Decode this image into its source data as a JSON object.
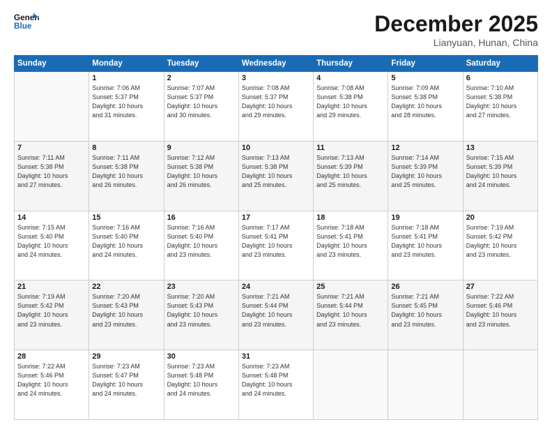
{
  "header": {
    "logo_general": "General",
    "logo_blue": "Blue",
    "month": "December 2025",
    "location": "Lianyuan, Hunan, China"
  },
  "days_of_week": [
    "Sunday",
    "Monday",
    "Tuesday",
    "Wednesday",
    "Thursday",
    "Friday",
    "Saturday"
  ],
  "weeks": [
    [
      {
        "day": "",
        "info": ""
      },
      {
        "day": "1",
        "info": "Sunrise: 7:06 AM\nSunset: 5:37 PM\nDaylight: 10 hours\nand 31 minutes."
      },
      {
        "day": "2",
        "info": "Sunrise: 7:07 AM\nSunset: 5:37 PM\nDaylight: 10 hours\nand 30 minutes."
      },
      {
        "day": "3",
        "info": "Sunrise: 7:08 AM\nSunset: 5:37 PM\nDaylight: 10 hours\nand 29 minutes."
      },
      {
        "day": "4",
        "info": "Sunrise: 7:08 AM\nSunset: 5:38 PM\nDaylight: 10 hours\nand 29 minutes."
      },
      {
        "day": "5",
        "info": "Sunrise: 7:09 AM\nSunset: 5:38 PM\nDaylight: 10 hours\nand 28 minutes."
      },
      {
        "day": "6",
        "info": "Sunrise: 7:10 AM\nSunset: 5:38 PM\nDaylight: 10 hours\nand 27 minutes."
      }
    ],
    [
      {
        "day": "7",
        "info": "Sunrise: 7:11 AM\nSunset: 5:38 PM\nDaylight: 10 hours\nand 27 minutes."
      },
      {
        "day": "8",
        "info": "Sunrise: 7:11 AM\nSunset: 5:38 PM\nDaylight: 10 hours\nand 26 minutes."
      },
      {
        "day": "9",
        "info": "Sunrise: 7:12 AM\nSunset: 5:38 PM\nDaylight: 10 hours\nand 26 minutes."
      },
      {
        "day": "10",
        "info": "Sunrise: 7:13 AM\nSunset: 5:38 PM\nDaylight: 10 hours\nand 25 minutes."
      },
      {
        "day": "11",
        "info": "Sunrise: 7:13 AM\nSunset: 5:39 PM\nDaylight: 10 hours\nand 25 minutes."
      },
      {
        "day": "12",
        "info": "Sunrise: 7:14 AM\nSunset: 5:39 PM\nDaylight: 10 hours\nand 25 minutes."
      },
      {
        "day": "13",
        "info": "Sunrise: 7:15 AM\nSunset: 5:39 PM\nDaylight: 10 hours\nand 24 minutes."
      }
    ],
    [
      {
        "day": "14",
        "info": "Sunrise: 7:15 AM\nSunset: 5:40 PM\nDaylight: 10 hours\nand 24 minutes."
      },
      {
        "day": "15",
        "info": "Sunrise: 7:16 AM\nSunset: 5:40 PM\nDaylight: 10 hours\nand 24 minutes."
      },
      {
        "day": "16",
        "info": "Sunrise: 7:16 AM\nSunset: 5:40 PM\nDaylight: 10 hours\nand 23 minutes."
      },
      {
        "day": "17",
        "info": "Sunrise: 7:17 AM\nSunset: 5:41 PM\nDaylight: 10 hours\nand 23 minutes."
      },
      {
        "day": "18",
        "info": "Sunrise: 7:18 AM\nSunset: 5:41 PM\nDaylight: 10 hours\nand 23 minutes."
      },
      {
        "day": "19",
        "info": "Sunrise: 7:18 AM\nSunset: 5:41 PM\nDaylight: 10 hours\nand 23 minutes."
      },
      {
        "day": "20",
        "info": "Sunrise: 7:19 AM\nSunset: 5:42 PM\nDaylight: 10 hours\nand 23 minutes."
      }
    ],
    [
      {
        "day": "21",
        "info": "Sunrise: 7:19 AM\nSunset: 5:42 PM\nDaylight: 10 hours\nand 23 minutes."
      },
      {
        "day": "22",
        "info": "Sunrise: 7:20 AM\nSunset: 5:43 PM\nDaylight: 10 hours\nand 23 minutes."
      },
      {
        "day": "23",
        "info": "Sunrise: 7:20 AM\nSunset: 5:43 PM\nDaylight: 10 hours\nand 23 minutes."
      },
      {
        "day": "24",
        "info": "Sunrise: 7:21 AM\nSunset: 5:44 PM\nDaylight: 10 hours\nand 23 minutes."
      },
      {
        "day": "25",
        "info": "Sunrise: 7:21 AM\nSunset: 5:44 PM\nDaylight: 10 hours\nand 23 minutes."
      },
      {
        "day": "26",
        "info": "Sunrise: 7:21 AM\nSunset: 5:45 PM\nDaylight: 10 hours\nand 23 minutes."
      },
      {
        "day": "27",
        "info": "Sunrise: 7:22 AM\nSunset: 5:46 PM\nDaylight: 10 hours\nand 23 minutes."
      }
    ],
    [
      {
        "day": "28",
        "info": "Sunrise: 7:22 AM\nSunset: 5:46 PM\nDaylight: 10 hours\nand 24 minutes."
      },
      {
        "day": "29",
        "info": "Sunrise: 7:23 AM\nSunset: 5:47 PM\nDaylight: 10 hours\nand 24 minutes."
      },
      {
        "day": "30",
        "info": "Sunrise: 7:23 AM\nSunset: 5:48 PM\nDaylight: 10 hours\nand 24 minutes."
      },
      {
        "day": "31",
        "info": "Sunrise: 7:23 AM\nSunset: 5:48 PM\nDaylight: 10 hours\nand 24 minutes."
      },
      {
        "day": "",
        "info": ""
      },
      {
        "day": "",
        "info": ""
      },
      {
        "day": "",
        "info": ""
      }
    ]
  ]
}
